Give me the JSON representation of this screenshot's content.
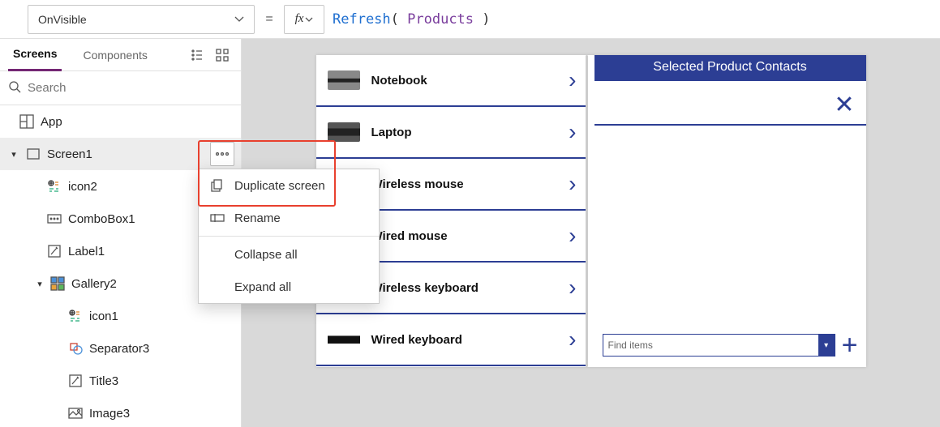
{
  "formula_bar": {
    "property": "OnVisible",
    "fx": "fx",
    "formula_fn": "Refresh",
    "formula_ds": "Products"
  },
  "tree": {
    "tabs": {
      "screens": "Screens",
      "components": "Components"
    },
    "search_placeholder": "Search",
    "app": "App",
    "screen1": "Screen1",
    "items": {
      "icon2": "icon2",
      "combobox1": "ComboBox1",
      "label1": "Label1",
      "gallery2": "Gallery2",
      "icon1": "icon1",
      "separator3": "Separator3",
      "title3": "Title3",
      "image3": "Image3"
    }
  },
  "context_menu": {
    "duplicate": "Duplicate screen",
    "rename": "Rename",
    "collapse": "Collapse all",
    "expand": "Expand all"
  },
  "app_canvas": {
    "gallery": [
      {
        "name": "Notebook"
      },
      {
        "name": "Laptop"
      },
      {
        "name": "Wireless mouse"
      },
      {
        "name": "Wired mouse"
      },
      {
        "name": "Wireless keyboard"
      },
      {
        "name": "Wired keyboard"
      }
    ],
    "panel_title": "Selected Product Contacts",
    "combo_placeholder": "Find items"
  }
}
